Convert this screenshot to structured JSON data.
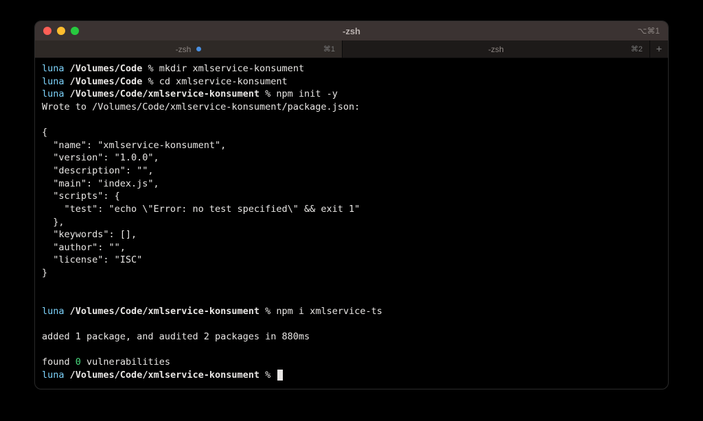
{
  "window": {
    "title": "-zsh",
    "shortcut": "⌥⌘1"
  },
  "tabs": [
    {
      "label": "-zsh",
      "shortcut": "⌘1",
      "active": true,
      "indicator": true
    },
    {
      "label": "-zsh",
      "shortcut": "⌘2",
      "active": false,
      "indicator": false
    }
  ],
  "prompt": {
    "host": "luna",
    "path1": "/Volumes/Code",
    "path2": "/Volumes/Code/xmlservice-konsument",
    "char": "%"
  },
  "cmds": {
    "c1": "mkdir xmlservice-konsument",
    "c2": "cd xmlservice-konsument",
    "c3": "npm init -y",
    "c4": "npm i xmlservice-ts"
  },
  "out": {
    "wroteTo": "Wrote to /Volumes/Code/xmlservice-konsument/package.json:",
    "brace_open": "{",
    "l_name": "  \"name\": \"xmlservice-konsument\",",
    "l_version": "  \"version\": \"1.0.0\",",
    "l_desc": "  \"description\": \"\",",
    "l_main": "  \"main\": \"index.js\",",
    "l_scripts": "  \"scripts\": {",
    "l_test": "    \"test\": \"echo \\\"Error: no test specified\\\" && exit 1\"",
    "l_scripts_close": "  },",
    "l_keywords": "  \"keywords\": [],",
    "l_author": "  \"author\": \"\",",
    "l_license": "  \"license\": \"ISC\"",
    "brace_close": "}",
    "added": "added 1 package, and audited 2 packages in 880ms",
    "found_pre": "found ",
    "found_zero": "0",
    "found_post": " vulnerabilities"
  }
}
